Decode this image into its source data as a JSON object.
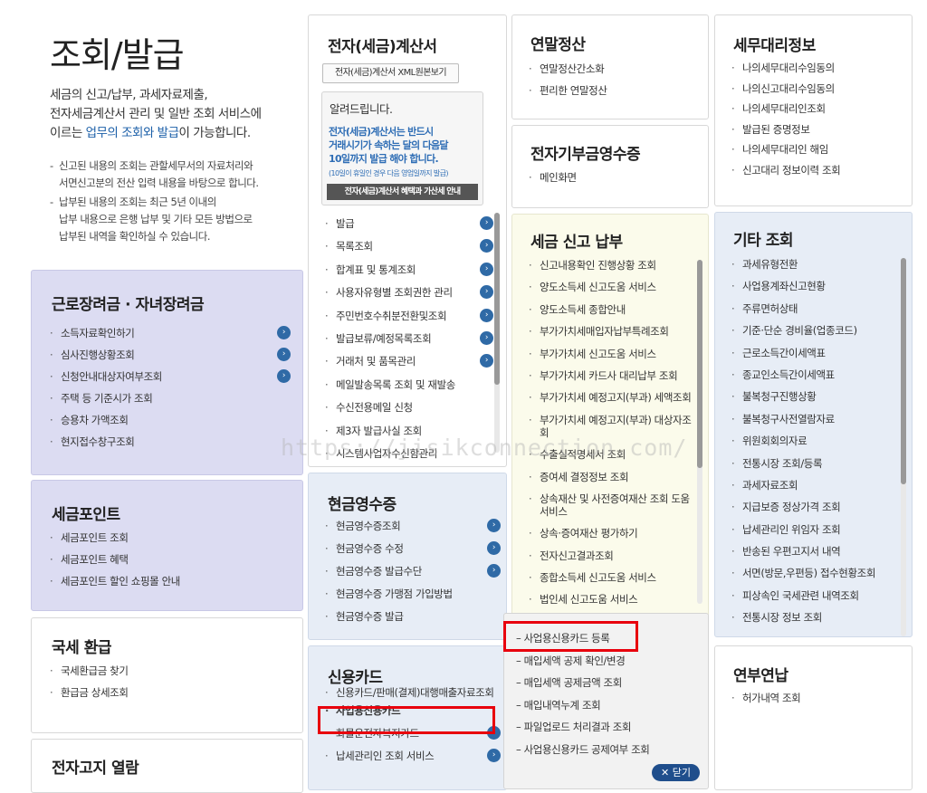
{
  "page_title": "조회/발급",
  "intro": {
    "line1": "세금의 신고/납부, 과세자료제출,",
    "line2": "전자세금계산서 관리 및 일반 조회 서비스에",
    "line3_pre": "이르는 ",
    "line3_link": "업무의 조회와 발급",
    "line3_post": "이 가능합니다."
  },
  "notes": [
    {
      "l1": "신고된 내용의 조회는 관할세무서의 자료처리와",
      "l2": "서면신고분의 전산 입력 내용을 바탕으로 합니다."
    },
    {
      "l1": "납부된 내용의 조회는 최근 5년 이내의",
      "l2": "납부 내용으로 은행 납부 및 기타 모든 방법으로",
      "l3": "납부된 내역을 확인하실 수 있습니다."
    }
  ],
  "work": {
    "title": "근로장려금 · 자녀장려금",
    "items": [
      "소득자료확인하기",
      "심사진행상황조회",
      "신청안내대상자여부조회",
      "주택 등 기준시가 조회",
      "승용차 가액조회",
      "현지접수창구조회"
    ]
  },
  "points": {
    "title": "세금포인트",
    "items": [
      "세금포인트 조회",
      "세금포인트 혜택",
      "세금포인트 할인 쇼핑몰 안내"
    ]
  },
  "refund": {
    "title": "국세 환급",
    "items": [
      "국세환급금 찾기",
      "환급금 상세조회"
    ]
  },
  "notice": {
    "title": "전자고지 열람"
  },
  "einvoice": {
    "title": "전자(세금)계산서",
    "xml_btn": "전자(세금)계산서 XML원본보기",
    "alert_title": "알려드립니다.",
    "alert_p1": "전자(세금)계산서는 반드시",
    "alert_p2": "거래시기가 속하는 달의 다음달",
    "alert_p3": "10일까지 발급 해야 합니다.",
    "alert_small": "(10일이 휴일인 경우 다음 영업일까지 발급)",
    "alert_btn": "전자(세금)계산서 혜택과 가산세 안내",
    "items": [
      "발급",
      "목록조회",
      "합계표 및 통계조회",
      "사용자유형별 조회권한 관리",
      "주민번호수취분전환및조회",
      "발급보류/예정목록조회",
      "거래처 및 품목관리",
      "메일발송목록 조회 및 재발송",
      "수신전용메일 신청",
      "제3자 발급사실 조회",
      "시스템사업자수신함관리"
    ]
  },
  "cash": {
    "title": "현금영수증",
    "items": [
      "현금영수증조회",
      "현금영수증 수정",
      "현금영수증 발급수단",
      "현금영수증 가맹점 가입방법",
      "현금영수증 발급"
    ]
  },
  "card": {
    "title": "신용카드",
    "items": [
      "신용카드/판매(결제)대행매출자료조회",
      "사업용신용카드",
      "화물운전자복지카드",
      "납세관리인 조회 서비스"
    ]
  },
  "submenu": {
    "items": [
      "사업용신용카드 등록",
      "매입세액 공제 확인/변경",
      "매입세액 공제금액 조회",
      "매입내역누계 조회",
      "파일업로드 처리결과 조회",
      "사업용신용카드 공제여부 조회"
    ],
    "close": "닫기"
  },
  "yearend": {
    "title": "연말정산",
    "items": [
      "연말정산간소화",
      "편리한 연말정산"
    ]
  },
  "donation": {
    "title": "전자기부금영수증",
    "items": [
      "메인화면"
    ]
  },
  "tax": {
    "title": "세금 신고 납부",
    "items": [
      "신고내용확인 진행상황 조회",
      "양도소득세 신고도움 서비스",
      "양도소득세 종합안내",
      "부가가치세매입자납부특례조회",
      "부가가치세 신고도움 서비스",
      "부가가치세 카드사 대리납부 조회",
      "부가가치세 예정고지(부과) 세액조회",
      "부가가치세 예정고지(부과) 대상자조회",
      "수출실적명세서 조회",
      "증여세 결정정보 조회",
      "상속재산 및 사전증여재산 조회 도움 서비스",
      "상속·증여재산 평가하기",
      "전자신고결과조회",
      "종합소득세 신고도움 서비스",
      "법인세 신고도움 서비스"
    ]
  },
  "agent": {
    "title": "세무대리정보",
    "items": [
      "나의세무대리수임동의",
      "나의신고대리수임동의",
      "나의세무대리인조회",
      "발급된 증명정보",
      "나의세무대리인 해임",
      "신고대리 정보이력 조회"
    ]
  },
  "other": {
    "title": "기타 조회",
    "items": [
      "과세유형전환",
      "사업용계좌신고현황",
      "주류면허상태",
      "기준·단순 경비율(업종코드)",
      "근로소득간이세액표",
      "종교인소득간이세액표",
      "불복청구진행상황",
      "불복청구사전열람자료",
      "위원회회의자료",
      "전통시장 조회/등록",
      "과세자료조회",
      "지급보증 정상가격 조회",
      "납세관리인 위임자 조회",
      "반송된 우편고지서 내역",
      "서면(방문,우편등) 접수현황조회",
      "피상속인 국세관련 내역조회",
      "전통시장 정보 조회"
    ]
  },
  "install": {
    "title": "연부연납",
    "items": [
      "허가내역 조회"
    ]
  },
  "watermark": "https://jisikconnection.com/",
  "colors": {
    "accent": "#1b5fa8",
    "highlight": "#e8000d",
    "arrow": "#2f6aa6"
  }
}
